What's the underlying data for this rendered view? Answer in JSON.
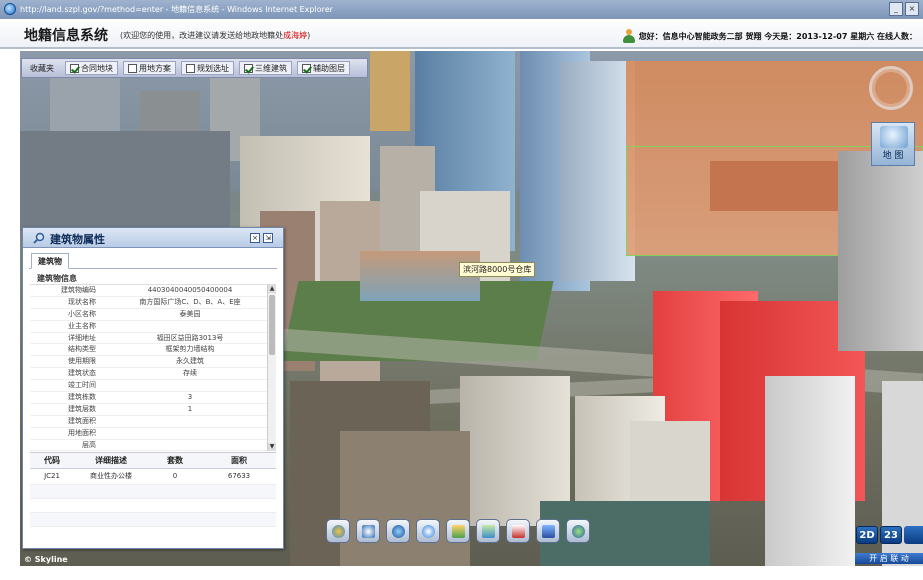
{
  "window": {
    "title": "http://land.szpl.gov/?method=enter - 地籍信息系统 - Windows Internet Explorer",
    "buttons": {
      "minimize": "_",
      "close": "×"
    }
  },
  "header": {
    "app_title": "地籍信息系统",
    "notice_prefix": "(欢迎您的使用，改进建议请发送给地政地籍处",
    "notice_link": "成海婷",
    "notice_suffix": ")",
    "user_text": "您好：信息中心智能政务二部 贺翔 今天是：2013-12-07 星期六 在线人数："
  },
  "layer_bar": {
    "items": [
      {
        "label": "收藏夹",
        "checked": null
      },
      {
        "label": "合同地块",
        "checked": true
      },
      {
        "label": "用地方案",
        "checked": false
      },
      {
        "label": "规划选址",
        "checked": false
      },
      {
        "label": "三维建筑",
        "checked": true
      },
      {
        "label": "辅助图层",
        "checked": true
      }
    ]
  },
  "map": {
    "road_label": "滨河路8000号仓库",
    "map_button_label": "地 图",
    "watermark": "© Skyline",
    "mode_2d": "2D",
    "mode_23": "23",
    "link_button": "开 启 联 动"
  },
  "panel": {
    "title": "建筑物属性",
    "tab": "建筑物",
    "section": "建筑物信息",
    "buttons": {
      "close": "×",
      "collapse": "⇲"
    },
    "attributes": [
      {
        "key": "建筑物编码",
        "value": "4403040040050400004"
      },
      {
        "key": "现状名称",
        "value": "南方国际广场C、D、B、A、E座"
      },
      {
        "key": "小区名称",
        "value": "泰美园"
      },
      {
        "key": "业主名称",
        "value": ""
      },
      {
        "key": "详细地址",
        "value": "福田区益田路3013号"
      },
      {
        "key": "结构类型",
        "value": "框架剪力墙结构"
      },
      {
        "key": "使用期限",
        "value": "永久建筑"
      },
      {
        "key": "建筑状态",
        "value": "存续"
      },
      {
        "key": "竣工时间",
        "value": ""
      },
      {
        "key": "建筑栋数",
        "value": "3"
      },
      {
        "key": "建筑层数",
        "value": "1"
      },
      {
        "key": "建筑面积",
        "value": ""
      },
      {
        "key": "用地面积",
        "value": ""
      },
      {
        "key": "层高",
        "value": ""
      }
    ],
    "grid": {
      "headers": [
        "代码",
        "详细描述",
        "套数",
        "面积"
      ],
      "rows": [
        {
          "code": "JC21",
          "desc": "商业性办公楼",
          "units": "0",
          "area": "67633"
        }
      ]
    }
  }
}
